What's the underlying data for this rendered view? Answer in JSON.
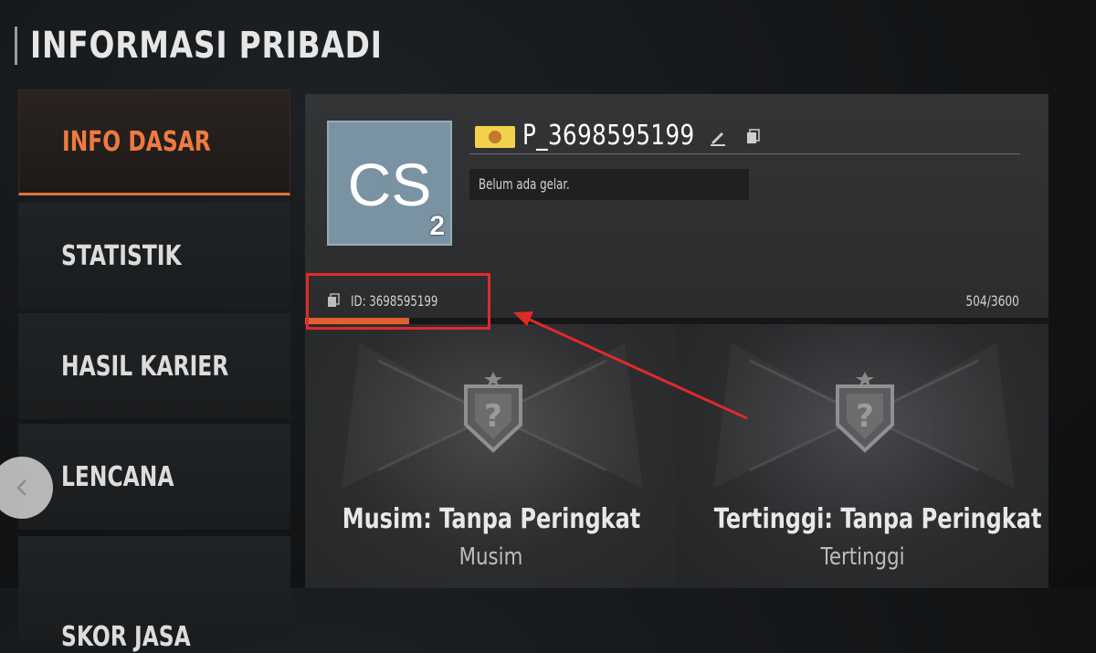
{
  "page": {
    "title": "INFORMASI PRIBADI"
  },
  "sidebar": {
    "items": [
      {
        "label": "INFO DASAR",
        "active": true
      },
      {
        "label": "STATISTIK",
        "active": false
      },
      {
        "label": "HASIL KARIER",
        "active": false
      },
      {
        "label": "LENCANA",
        "active": false
      },
      {
        "label": "SKOR JASA",
        "active": false
      }
    ]
  },
  "back_button": {
    "icon": "chevron-left-icon"
  },
  "profile": {
    "avatar_initials": "CS",
    "avatar_level": "2",
    "flag_icon": "flag-icon",
    "username": "P_3698595199",
    "title_text": "Belum ada gelar.",
    "player_id": "ID: 3698595199",
    "xp_text": "504/3600",
    "xp_progress": 0.14
  },
  "ranks": [
    {
      "name": "Musim: Tanpa Peringkat",
      "label": "Musim"
    },
    {
      "name": "Tertinggi: Tanpa Peringkat",
      "label": "Tertinggi"
    }
  ],
  "colors": {
    "accent": "#e0713a",
    "highlight": "#e02a2a",
    "avatar_bg": "#7a93a2"
  }
}
